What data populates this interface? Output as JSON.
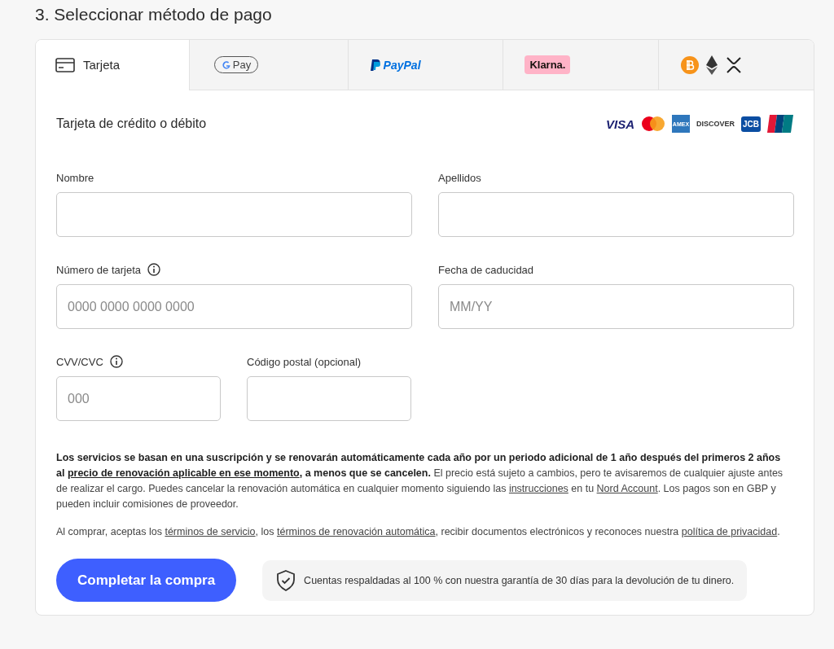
{
  "heading": "3. Seleccionar método de pago",
  "tabs": [
    {
      "kind": "card",
      "label": "Tarjeta",
      "selected": true
    },
    {
      "kind": "gpay",
      "label": "Pay",
      "selected": false
    },
    {
      "kind": "paypal",
      "label": "PayPal",
      "selected": false
    },
    {
      "kind": "klarna",
      "label": "Klarna.",
      "selected": false
    },
    {
      "kind": "crypto",
      "selected": false
    }
  ],
  "form_title": "Tarjeta de crédito o débito",
  "card_brands": [
    {
      "kind": "visa",
      "label": "VISA"
    },
    {
      "kind": "mastercard"
    },
    {
      "kind": "amex",
      "label": "AMEX"
    },
    {
      "kind": "discover",
      "label": "DISCOVER"
    },
    {
      "kind": "jcb",
      "label": "JCB"
    },
    {
      "kind": "unionpay"
    }
  ],
  "fields": [
    {
      "label": "Nombre",
      "kind": "wide"
    },
    {
      "label": "Apellidos",
      "kind": "wide"
    },
    {
      "label": "Número de tarjeta",
      "info": true,
      "placeholder": "0000 0000 0000 0000",
      "kind": "wide"
    },
    {
      "label": "Fecha de caducidad",
      "placeholder": "MM/YY",
      "kind": "wide"
    },
    {
      "label": "CVV/CVC",
      "info": true,
      "placeholder": "000",
      "kind": "narrow"
    },
    {
      "label": "Código postal (opcional)",
      "kind": "narrow"
    }
  ],
  "paragraphs": [
    [
      {
        "text": "Los servicios se basan en una suscripción y se renovarán automáticamente cada año por un periodo adicional de 1 año después del primeros 2 años al ",
        "bold": true
      },
      {
        "text": "precio de renovación aplicable en ese momento",
        "bold": true,
        "link": true
      },
      {
        "text": ", a menos que se cancelen.",
        "bold": true
      },
      {
        "text": " El precio está sujeto a cambios, pero te avisaremos de cualquier ajuste antes de realizar el cargo. Puedes cancelar la renovación automática en cualquier momento siguiendo las "
      },
      {
        "text": "instrucciones",
        "link": true
      },
      {
        "text": " en tu "
      },
      {
        "text": "Nord Account",
        "link": true
      },
      {
        "text": ". Los pagos son en GBP y pueden incluir comisiones de proveedor."
      }
    ],
    [
      {
        "text": "Al comprar, aceptas los "
      },
      {
        "text": "términos de servicio",
        "link": true
      },
      {
        "text": ", los "
      },
      {
        "text": "términos de renovación automática",
        "link": true
      },
      {
        "text": ", recibir documentos electrónicos y reconoces nuestra "
      },
      {
        "text": "política de privacidad",
        "link": true
      },
      {
        "text": "."
      }
    ]
  ],
  "submit_button": "Completar la compra",
  "guarantee": "Cuentas respaldadas al 100 % con nuestra garantía de 30 días para la devolución de tu dinero."
}
